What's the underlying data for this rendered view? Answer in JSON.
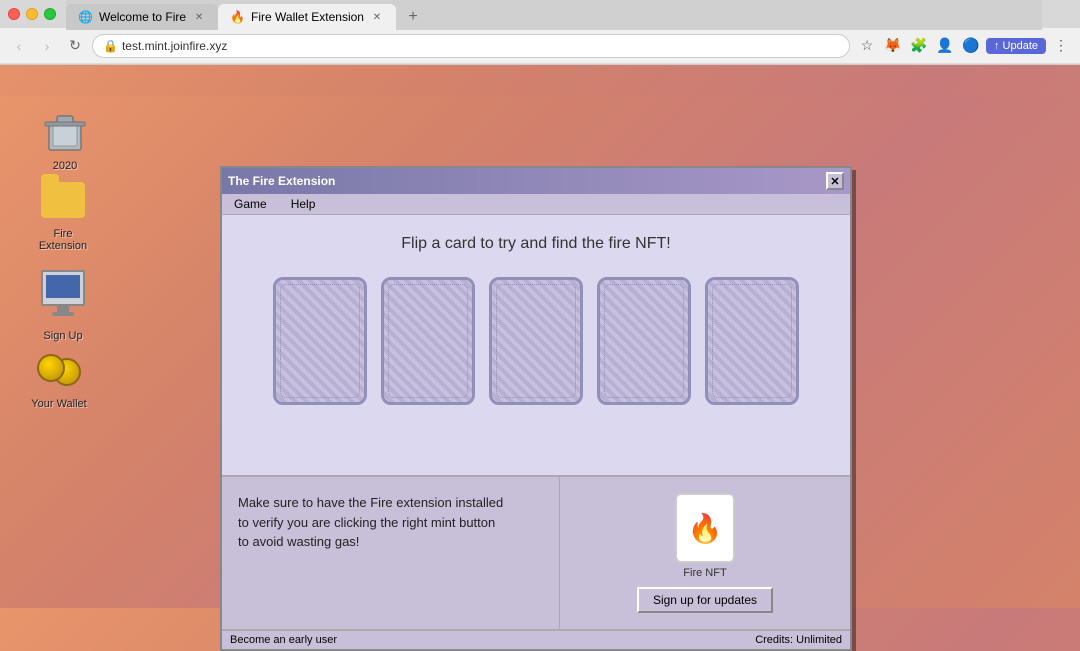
{
  "browser": {
    "tabs": [
      {
        "label": "Welcome to Fire",
        "url": "",
        "active": false,
        "favicon": "🌐"
      },
      {
        "label": "Fire Wallet Extension",
        "url": "",
        "active": true,
        "favicon": "🔥"
      }
    ],
    "address": "test.mint.joinfire.xyz",
    "update_btn": "Update"
  },
  "desktop": {
    "icons": [
      {
        "id": "trash",
        "label": "2020",
        "type": "trash"
      },
      {
        "id": "fire-extension",
        "label": "Fire Extension",
        "type": "folder"
      },
      {
        "id": "sign-up",
        "label": "Sign Up",
        "type": "monitor"
      },
      {
        "id": "your-wallet",
        "label": "Your Wallet",
        "type": "coins"
      }
    ]
  },
  "dialog": {
    "title": "The Fire Extension",
    "menu_items": [
      "Game",
      "Help"
    ],
    "heading": "Flip a card to try and find the fire NFT!",
    "cards_count": 5,
    "close_btn": "✕",
    "bottom_left_text": "Make sure to have the Fire extension installed\nto verify you are clicking the right mint button\nto avoid wasting gas!",
    "nft_card_emoji": "🔥",
    "nft_label": "Fire NFT",
    "signup_btn": "Sign up for updates",
    "status_left": "Become an early user",
    "status_right": "Credits: Unlimited"
  }
}
